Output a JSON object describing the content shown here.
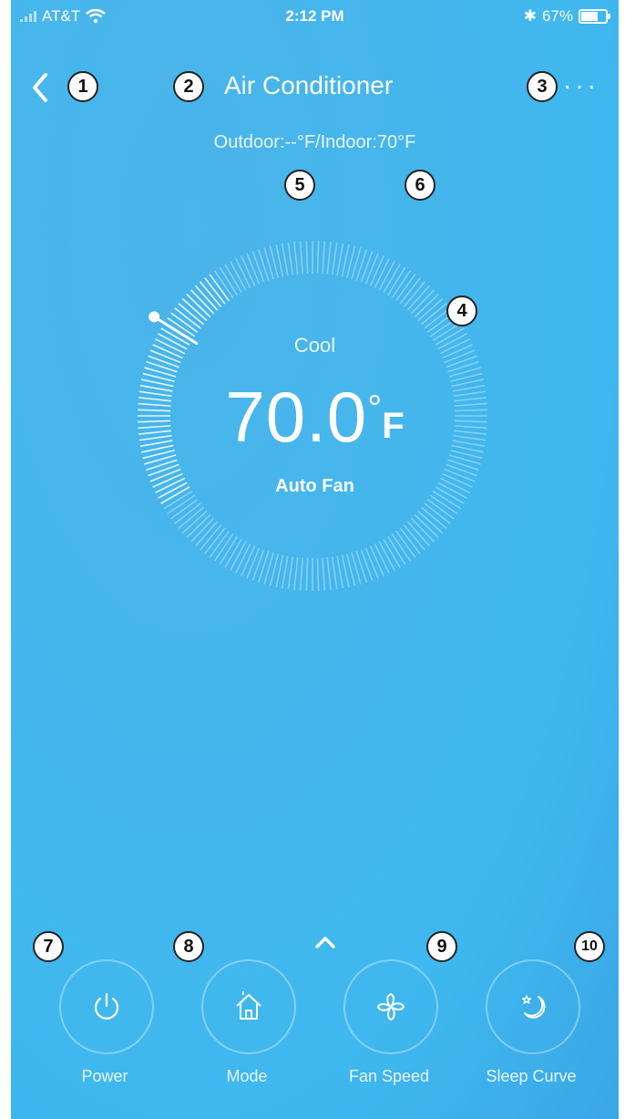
{
  "status": {
    "carrier": "AT&T",
    "time": "2:12 PM",
    "battery": "67%"
  },
  "header": {
    "title": "Air Conditioner",
    "more": "···"
  },
  "temperatures": {
    "text": "Outdoor:--°F/Indoor:70°F"
  },
  "dial": {
    "mode": "Cool",
    "value": "70.0",
    "degree": "°",
    "unit": "F",
    "fan": "Auto Fan"
  },
  "callouts": [
    "1",
    "2",
    "3",
    "4",
    "5",
    "6",
    "7",
    "8",
    "9",
    "10"
  ],
  "controls": [
    {
      "label": "Power",
      "icon": "power-icon"
    },
    {
      "label": "Mode",
      "icon": "home-icon"
    },
    {
      "label": "Fan Speed",
      "icon": "fan-icon"
    },
    {
      "label": "Sleep Curve",
      "icon": "moon-star-icon"
    }
  ],
  "colors": {
    "background": "#45b6ec",
    "foreground": "#ffffff"
  }
}
